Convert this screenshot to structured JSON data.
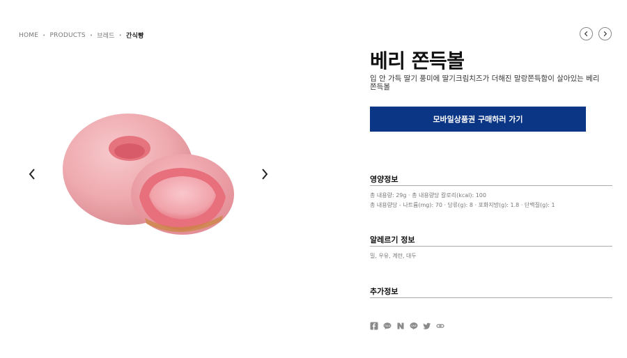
{
  "breadcrumb": {
    "items": [
      "HOME",
      "PRODUCTS",
      "브레드",
      "간식빵"
    ]
  },
  "nav": {
    "prev_icon": "chevron-left-icon",
    "next_icon": "chevron-right-icon"
  },
  "product": {
    "title": "베리 쫀득볼",
    "description": "입 안 가득 딸기 풍미에 딸기크림치즈가 더해진 말랑쫀득함이 살아있는 베리쫀득볼",
    "image_alt": "베리 쫀득볼"
  },
  "buy_button": {
    "label": "모바일상품권 구매하러 가기",
    "color": "#0b3686"
  },
  "nutrition": {
    "title": "영양정보",
    "line1": "총 내용량: 29g · 총 내용량당 칼로리(kcal): 100",
    "line2": "총 내용량당 - 나트륨(mg): 70 · 당류(g): 8 · 포화지방(g): 1.8 · 단백질(g): 1"
  },
  "allergy": {
    "title": "알레르기 정보",
    "text": "밀, 우유, 계란, 대두"
  },
  "extra": {
    "title": "추가정보"
  },
  "share_icons": [
    "facebook-icon",
    "kakaotalk-icon",
    "naver-icon",
    "line-icon",
    "twitter-icon",
    "link-icon"
  ]
}
